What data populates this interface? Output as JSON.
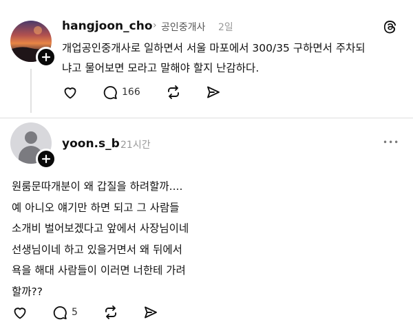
{
  "post1": {
    "username": "hangjoon_cho",
    "chevron": "›",
    "topic": "공인중개사",
    "time": "2일",
    "lines": [
      "개업공인중개사로 일하면서 서울 마포에서 300/35 구하면서 주차되",
      "냐고 물어보면 모라고 말해야 할지 난감하다."
    ],
    "reply_count": "166",
    "icons": [
      "heart-icon",
      "comment-icon",
      "repost-icon",
      "share-icon",
      "threads-logo-icon",
      "plus-icon"
    ]
  },
  "post2": {
    "username": "yoon.s_b",
    "time": "21시간",
    "more": "•••",
    "lines": [
      "원룸문따개분이 왜 갑질을 하려할까....",
      "예 아니오 얘기만 하면 되고 그 사람들",
      "소개비 벌어보겠다고 앞에서 사장님이네",
      "선생님이네 하고 있을거면서 왜 뒤에서",
      "욕을 해대 사람들이 이러면 너한테 가려",
      "할까??"
    ],
    "reply_count": "5",
    "icons": [
      "heart-icon",
      "comment-icon",
      "repost-icon",
      "share-icon",
      "more-icon",
      "plus-icon"
    ]
  },
  "colors": {
    "text": "#111111",
    "muted": "#999999",
    "divider": "#dedede"
  }
}
